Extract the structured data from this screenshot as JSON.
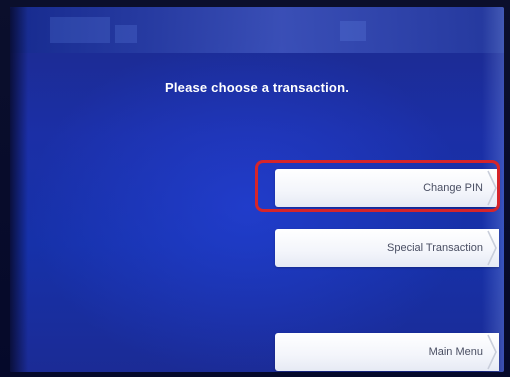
{
  "screen": {
    "prompt": "Please choose a transaction."
  },
  "options": [
    {
      "label": "Change PIN",
      "icon": "chevron-right-icon"
    },
    {
      "label": "Special Transaction",
      "icon": "chevron-right-icon"
    },
    {
      "label": "Main Menu",
      "icon": "chevron-right-icon"
    }
  ],
  "colors": {
    "screen_blue": "#1b2fa6",
    "button_white": "#ffffff",
    "highlight_red": "#d6252a"
  }
}
